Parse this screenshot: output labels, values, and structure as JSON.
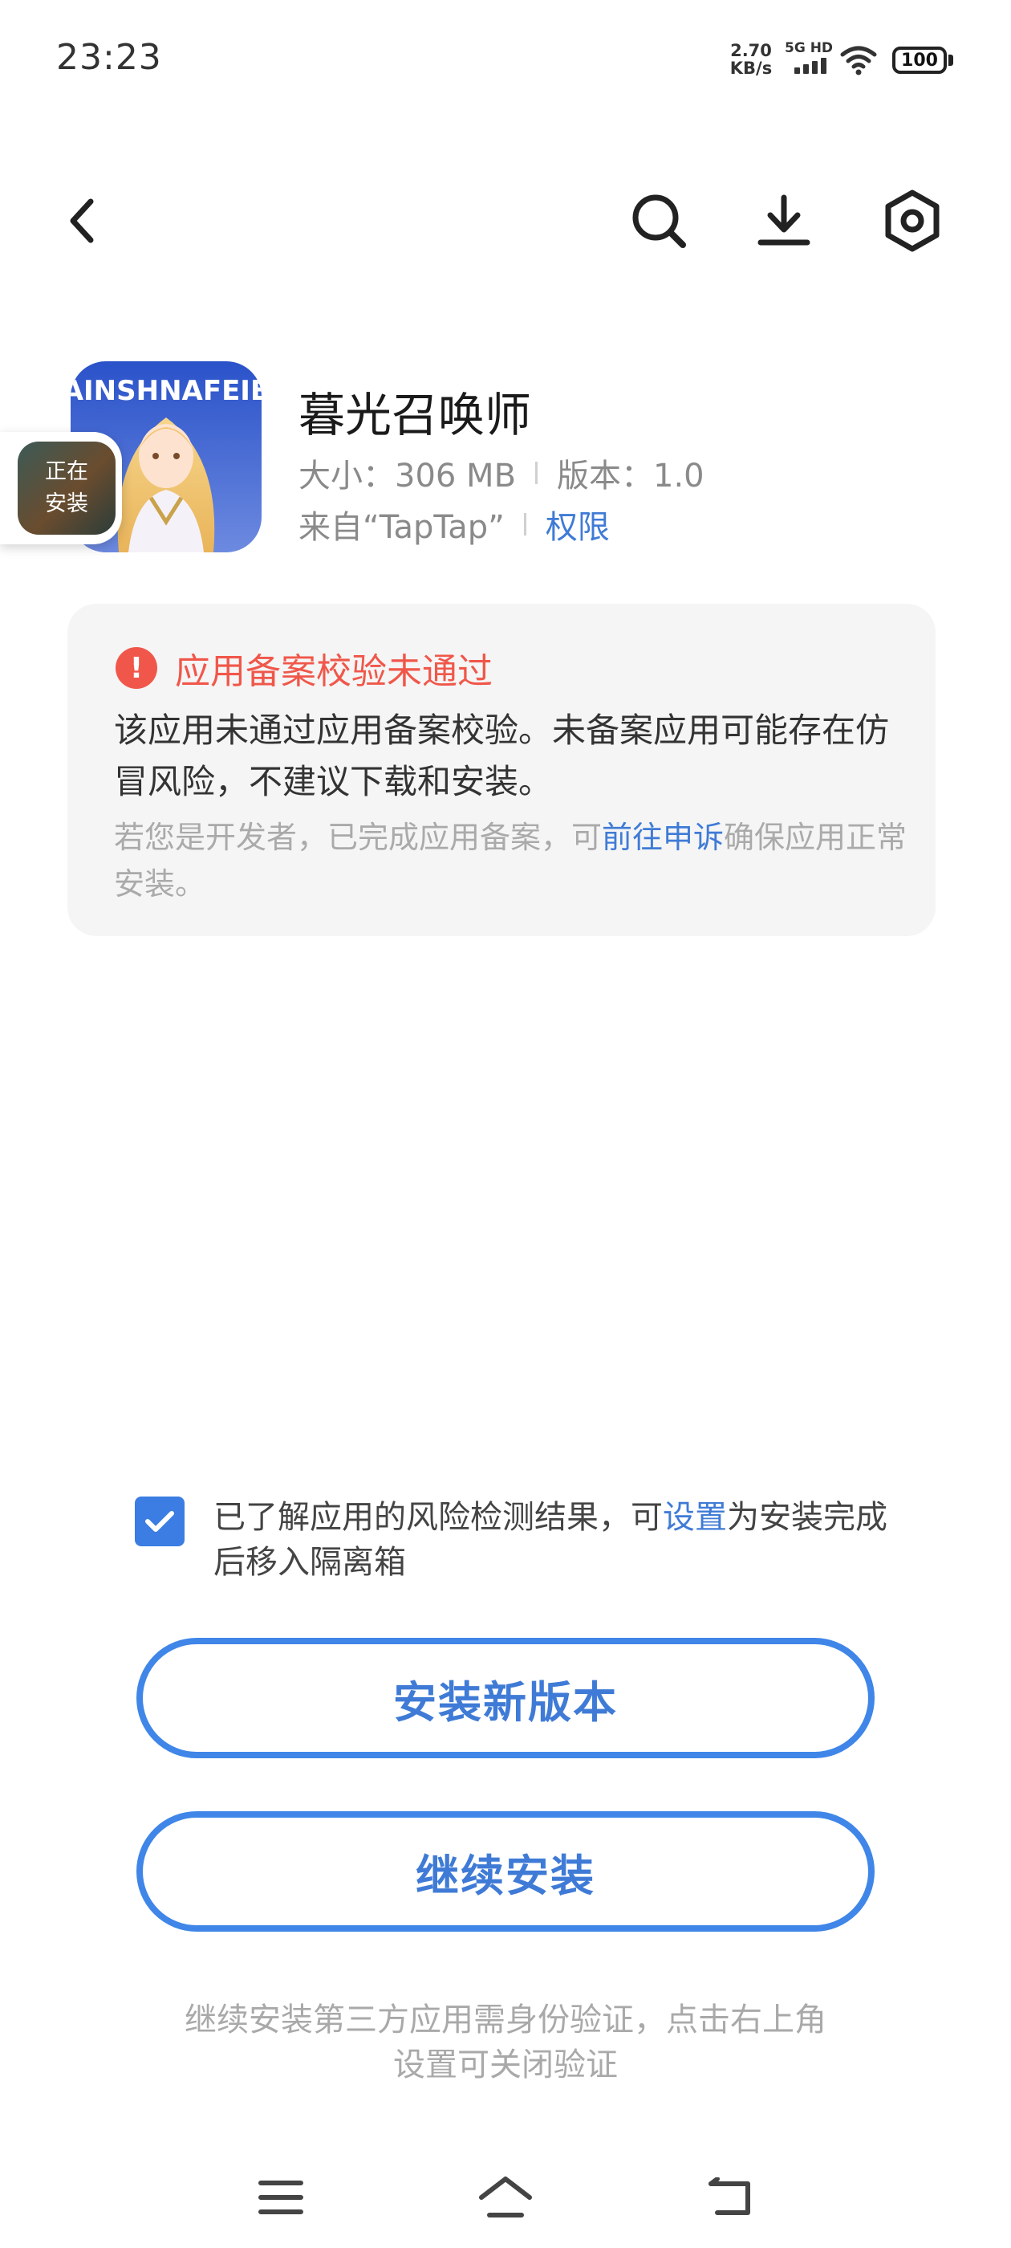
{
  "status_bar": {
    "time": "23:23",
    "net_speed_value": "2.70",
    "net_speed_unit": "KB/s",
    "signal_label": "5G HD",
    "battery": "100"
  },
  "toolbar": {
    "back_icon": "chevron-left-icon",
    "search_icon": "search-icon",
    "download_icon": "download-icon",
    "settings_icon": "gear-icon"
  },
  "app": {
    "name": "暮光召唤师",
    "icon_banner_text": "TAINSHNAFEIEL",
    "size_text": "大小：306 MB",
    "version_text": "版本：1.0",
    "source_text": "来自“TapTap”",
    "permissions_link": "权限",
    "installing_badge": "正在安装"
  },
  "warning": {
    "title": "应用备案校验未通过",
    "body": "该应用未通过应用备案校验。未备案应用可能存在仿冒风险，不建议下载和安装。",
    "hint_prefix": "若您是开发者，已完成应用备案，可",
    "hint_link": "前往申诉",
    "hint_suffix": "确保应用正常安装。"
  },
  "consent": {
    "checked": true,
    "text_prefix": "已了解应用的风险检测结果，可",
    "text_link": "设置",
    "text_suffix": "为安装完成后移入隔离箱"
  },
  "buttons": {
    "install_new_version": "安装新版本",
    "continue_install": "继续安装"
  },
  "footnote": "继续安装第三方应用需身份验证，点击右上角设置可关闭验证",
  "nav_bar": {
    "menu_icon": "menu-icon",
    "home_icon": "home-icon",
    "back_icon": "back-icon"
  },
  "colors": {
    "accent": "#3f7bd6",
    "warning": "#f0574a",
    "card_bg": "#f5f5f5"
  }
}
